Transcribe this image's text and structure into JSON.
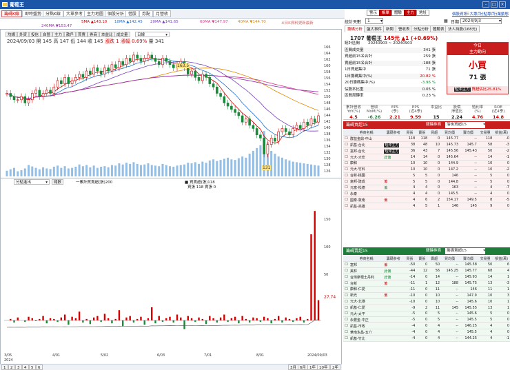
{
  "window": {
    "title": "葡萄王",
    "controls": [
      "-",
      "□",
      "×"
    ]
  },
  "toolbar": {
    "tabs": [
      {
        "label": "籌碼K線",
        "active": true
      },
      {
        "label": "即時盤勢",
        "active": false
      },
      {
        "label": "分點K線",
        "active": false
      },
      {
        "label": "大單參考",
        "active": false
      },
      {
        "label": "主力地圖",
        "active": false
      },
      {
        "label": "個股分析",
        "active": false
      },
      {
        "label": "借股",
        "active": false
      },
      {
        "label": "券配",
        "active": false
      },
      {
        "label": "月營收",
        "active": false
      }
    ]
  },
  "ma_legend": [
    {
      "label": "5MA ▲143.10",
      "color": "#d40000"
    },
    {
      "label": "10MA ▲142.45",
      "color": "#1f6fd4"
    },
    {
      "label": "20MA ▲141.65",
      "color": "#7a3fc0"
    },
    {
      "label": "60MA ▼147.97",
      "color": "#d63a8c"
    },
    {
      "label": "40MA ▼144.70",
      "color": "#e08a00"
    }
  ],
  "ma_legend2": {
    "label": "240MA ▼153.47",
    "color": "#9b2fb0"
  },
  "chart_toolbar": {
    "buttons": [
      "均線",
      "外資",
      "投信",
      "自營",
      "主力",
      "散戶",
      "買賣",
      "券商",
      "本益比",
      "成交量",
      "日線"
    ],
    "note": "※日K資料更新最新",
    "status": "日線"
  },
  "quote_info": {
    "date": "2024/09/03",
    "open_label": "開",
    "open": "145",
    "high_label": "高",
    "high": "147",
    "low_label": "低",
    "low": "144",
    "close_label": "收",
    "close": "145",
    "change_label": "漲跌",
    "change": "1",
    "pct_label": "漲幅",
    "pct": "0.69%",
    "vol_label": "量",
    "vol": "341"
  },
  "price_axis": [
    "166",
    "164",
    "162",
    "160",
    "158",
    "156",
    "154",
    "152",
    "150",
    "148",
    "146",
    "144",
    "142",
    "140",
    "138",
    "136",
    "134",
    "132",
    "130",
    "128",
    "126"
  ],
  "peak_label": "163.5",
  "low_label": "131",
  "sub_panel": {
    "select": "分點進出",
    "button": "總數",
    "legend_total": "一累計買賣超(張)200",
    "legend_buy": "■ 買賣超(張)118",
    "legend_sell": "買張 118 賣張 0",
    "axis": [
      "150",
      "100",
      "50"
    ],
    "current_value": "27.74"
  },
  "x_axis": [
    "3/05",
    "4/01",
    "5/02",
    "6/03",
    "7/01",
    "8/01",
    "2024/09/03"
  ],
  "x_axis_year": "2024",
  "bottom_tabs": [
    "1",
    "2",
    "3",
    "4",
    "5",
    "6"
  ],
  "period_buttons": [
    "3月",
    "6月",
    "1年",
    "10年",
    "2年"
  ],
  "right_nav": {
    "buttons": [
      {
        "label": "警示",
        "style": "normal"
      },
      {
        "label": "帳單",
        "style": "red"
      },
      {
        "label": "體驗",
        "style": "normal"
      },
      {
        "label": "主力",
        "style": "red"
      },
      {
        "label": "地址",
        "style": "normal"
      }
    ],
    "links": [
      "個股資訊",
      "三大專戶",
      "分點專戶",
      "行業動態"
    ]
  },
  "filter": {
    "label": "統計天數",
    "days": "1",
    "date_label": "日期",
    "date": "2024/9/3"
  },
  "right_tabs": [
    {
      "label": "籌碼分析",
      "active": true
    },
    {
      "label": "盤大事件",
      "active": false
    },
    {
      "label": "新聞",
      "active": false
    },
    {
      "label": "營收表",
      "active": false
    },
    {
      "label": "分點分析",
      "active": false
    },
    {
      "label": "體驗表",
      "active": false
    },
    {
      "label": "法人持股(168元)",
      "active": false
    }
  ],
  "stock": {
    "code_name": "1707 葡萄王",
    "price": "145元",
    "change": "▲1 (+0.69%)"
  },
  "stats": [
    {
      "label": "統計區間",
      "value": "20240903 ~ 20240903",
      "color": ""
    },
    {
      "label": "區間成交量",
      "value": "341 張",
      "color": ""
    },
    {
      "label": "買超前15名合計",
      "value": "259 張",
      "color": ""
    },
    {
      "label": "賣超前15名合計",
      "value": "-188 張",
      "color": ""
    },
    {
      "label": "1日買超集中",
      "value": "71 張",
      "color": ""
    },
    {
      "label": "1日籌碼集中(%)",
      "value": "20.82 %",
      "color": "#d40000"
    },
    {
      "label": "20日籌碼集中(%)",
      "value": "-3.96 %",
      "color": "#1a8a3a"
    },
    {
      "label": "佔股本比重",
      "value": "0.05 %",
      "color": ""
    },
    {
      "label": "區間周轉率",
      "value": "0.23 %",
      "color": ""
    }
  ],
  "today_box": {
    "title": "今日",
    "subtitle": "主力動向",
    "main": "小買",
    "lots": "71 張",
    "footer_label": "短沖主力",
    "footer_value": "買超佔比25.81%"
  },
  "fin_headers": [
    "累計營收\nYoY(%)",
    "營收\nMoM(%)",
    "EPS\n(季)",
    "EPS\n(近4季)",
    "本益比",
    "股價\n淨值比",
    "殖利率\n(%)",
    "ROE\n(近4季)"
  ],
  "fin_values": [
    {
      "v": "4.5",
      "c": "#d40000"
    },
    {
      "v": "-6.26",
      "c": "#1a8a3a"
    },
    {
      "v": "2.21",
      "c": "#d40000"
    },
    {
      "v": "9.59",
      "c": "#d40000"
    },
    {
      "v": "15",
      "c": "#222"
    },
    {
      "v": "2.24",
      "c": "#222"
    },
    {
      "v": "4.76",
      "c": "#d40000"
    },
    {
      "v": "14.8",
      "c": "#d40000"
    }
  ],
  "buy_section": {
    "title": "籌碼買超15",
    "select_label": "關鍵券商",
    "select_value": "落後買超15",
    "headers": [
      "",
      "券商名稱",
      "籌碼參考",
      "買張",
      "賣張",
      "買超",
      "買均價",
      "賣均價",
      "交易量",
      "損益(萬)"
    ],
    "rows": [
      {
        "name": "群益金鼎-中山",
        "tag": "",
        "tagc": "",
        "buy": "118",
        "sell": "118",
        "net": "0",
        "bavg": "145.77",
        "savg": "--",
        "vol": "118",
        "pl": "-0"
      },
      {
        "name": "凱基-台北",
        "tag": "短沖主力",
        "tagc": "blk",
        "buy": "38",
        "sell": "48",
        "net": "10",
        "bavg": "145.73",
        "savg": "145.7",
        "vol": "58",
        "pl": "-3"
      },
      {
        "name": "富邦-台北",
        "tag": "短沖主力",
        "tagc": "blk",
        "buy": "36",
        "sell": "43",
        "net": "7",
        "bavg": "145.56",
        "savg": "145.43",
        "vol": "50",
        "pl": "-2"
      },
      {
        "name": "元大-大安",
        "tag": "此偏",
        "tagc": "grn",
        "buy": "14",
        "sell": "14",
        "net": "0",
        "bavg": "145.64",
        "savg": "--",
        "vol": "14",
        "pl": "-1"
      },
      {
        "name": "康和",
        "tag": "",
        "tagc": "",
        "buy": "10",
        "sell": "10",
        "net": "0",
        "bavg": "144.9",
        "savg": "--",
        "vol": "10",
        "pl": "0"
      },
      {
        "name": "元大-竹科",
        "tag": "",
        "tagc": "",
        "buy": "10",
        "sell": "10",
        "net": "0",
        "bavg": "147.2",
        "savg": "--",
        "vol": "10",
        "pl": "-2"
      },
      {
        "name": "台新-桃園",
        "tag": "",
        "tagc": "",
        "buy": "5",
        "sell": "5",
        "net": "0",
        "bavg": "146",
        "savg": "--",
        "vol": "5",
        "pl": "0"
      },
      {
        "name": "富邦-建成",
        "tag": "偏",
        "tagc": "red",
        "buy": "5",
        "sell": "5",
        "net": "0",
        "bavg": "144.8",
        "savg": "--",
        "vol": "5",
        "pl": "0"
      },
      {
        "name": "元富-松德",
        "tag": "偏",
        "tagc": "grn",
        "buy": "4",
        "sell": "4",
        "net": "0",
        "bavg": "163",
        "savg": "--",
        "vol": "4",
        "pl": "-7"
      },
      {
        "name": "永泰",
        "tag": "",
        "tagc": "",
        "buy": "4",
        "sell": "4",
        "net": "0",
        "bavg": "145.5",
        "savg": "--",
        "vol": "4",
        "pl": "0"
      },
      {
        "name": "國泰-敦南",
        "tag": "偏",
        "tagc": "red",
        "buy": "4",
        "sell": "6",
        "net": "2",
        "bavg": "154.17",
        "savg": "149.5",
        "vol": "8",
        "pl": "-5"
      },
      {
        "name": "凱基-高雄",
        "tag": "",
        "tagc": "",
        "buy": "4",
        "sell": "5",
        "net": "1",
        "bavg": "146",
        "savg": "145",
        "vol": "9",
        "pl": "0"
      }
    ]
  },
  "sell_section": {
    "title": "籌碼賣超15",
    "select_label": "關鍵券商",
    "select_value": "籌碼賣超15",
    "headers": [
      "",
      "券商名稱",
      "籌碼參考",
      "買張",
      "賣張",
      "賣超",
      "買均價",
      "賣均價",
      "交易量",
      "損益(萬)"
    ],
    "rows": [
      {
        "name": "富邦",
        "tag": "偏",
        "tagc": "red",
        "buy": "-50",
        "sell": "0",
        "net": "50",
        "bavg": "--",
        "savg": "145.58",
        "vol": "50",
        "pl": "6"
      },
      {
        "name": "美林",
        "tag": "此偏",
        "tagc": "grn",
        "buy": "-44",
        "sell": "12",
        "net": "56",
        "bavg": "145.25",
        "savg": "145.77",
        "vol": "68",
        "pl": "4"
      },
      {
        "name": "台灣摩根士丹利",
        "tag": "此偏",
        "tagc": "grn",
        "buy": "-14",
        "sell": "0",
        "net": "14",
        "bavg": "--",
        "savg": "145.93",
        "vol": "14",
        "pl": "1"
      },
      {
        "name": "台新",
        "tag": "偏",
        "tagc": "red",
        "buy": "-11",
        "sell": "1",
        "net": "12",
        "bavg": "188",
        "savg": "145.75",
        "vol": "13",
        "pl": "-3"
      },
      {
        "name": "康和-仁愛",
        "tag": "",
        "tagc": "",
        "buy": "-11",
        "sell": "0",
        "net": "11",
        "bavg": "--",
        "savg": "146",
        "vol": "11",
        "pl": "1"
      },
      {
        "name": "新光",
        "tag": "偏",
        "tagc": "red",
        "buy": "-10",
        "sell": "0",
        "net": "10",
        "bavg": "--",
        "savg": "147.9",
        "vol": "10",
        "pl": "3"
      },
      {
        "name": "元大-北港",
        "tag": "",
        "tagc": "",
        "buy": "-10",
        "sell": "0",
        "net": "10",
        "bavg": "--",
        "savg": "145.6",
        "vol": "10",
        "pl": "1"
      },
      {
        "name": "凱基-仁愛",
        "tag": "",
        "tagc": "",
        "buy": "-9",
        "sell": "2",
        "net": "11",
        "bavg": "145",
        "savg": "145.55",
        "vol": "13",
        "pl": "1"
      },
      {
        "name": "元大-太平",
        "tag": "",
        "tagc": "",
        "buy": "-5",
        "sell": "0",
        "net": "5",
        "bavg": "--",
        "savg": "145.6",
        "vol": "5",
        "pl": "0"
      },
      {
        "name": "永豐金-中正",
        "tag": "",
        "tagc": "",
        "buy": "-5",
        "sell": "0",
        "net": "5",
        "bavg": "--",
        "savg": "145.5",
        "vol": "5",
        "pl": "0"
      },
      {
        "name": "凱基-市政",
        "tag": "",
        "tagc": "",
        "buy": "-4",
        "sell": "0",
        "net": "4",
        "bavg": "--",
        "savg": "146.25",
        "vol": "4",
        "pl": "0"
      },
      {
        "name": "華南永昌-五介",
        "tag": "",
        "tagc": "",
        "buy": "-4",
        "sell": "0",
        "net": "4",
        "bavg": "--",
        "savg": "145.5",
        "vol": "4",
        "pl": "0"
      },
      {
        "name": "凱基-竹北",
        "tag": "",
        "tagc": "",
        "buy": "-4",
        "sell": "0",
        "net": "4",
        "bavg": "--",
        "savg": "144.25",
        "vol": "4",
        "pl": "-1"
      }
    ]
  },
  "colors": {
    "accent": "#1b55a8",
    "up": "#d40000",
    "down": "#1a8a3a",
    "volume": "#6fa8dc"
  },
  "chart_data": {
    "type": "candlestick",
    "title": "",
    "ylim": [
      126,
      167
    ],
    "x_labels": [
      "3/05",
      "4/01",
      "5/02",
      "6/03",
      "7/01",
      "8/01",
      "2024/09/03"
    ],
    "close_series": [
      152,
      151,
      150,
      150,
      151,
      149,
      150,
      152,
      153,
      151,
      152,
      153,
      152,
      154,
      156,
      155,
      157,
      155,
      156,
      157,
      158,
      157,
      159,
      158,
      160,
      159,
      158,
      160,
      159,
      161,
      160,
      162,
      161,
      163,
      162,
      164,
      163,
      162,
      163,
      164,
      163,
      162,
      161,
      163,
      162,
      161,
      160,
      161,
      162,
      160,
      158,
      159,
      157,
      156,
      158,
      157,
      155,
      154,
      152,
      151,
      149,
      148,
      147,
      146,
      145,
      143,
      144,
      142,
      141,
      139,
      138,
      133,
      136,
      138,
      137,
      140,
      141,
      140,
      139,
      141,
      142,
      141,
      143,
      142,
      144,
      143,
      145
    ],
    "ma_series": [
      {
        "name": "5MA",
        "color": "#d40000"
      },
      {
        "name": "10MA",
        "color": "#1f6fd4"
      },
      {
        "name": "20MA",
        "color": "#7a3fc0"
      },
      {
        "name": "60MA",
        "color": "#d63a8c"
      },
      {
        "name": "40MA",
        "color": "#e08a00"
      },
      {
        "name": "240MA",
        "color": "#9b2fb0"
      }
    ],
    "volume": [
      20,
      25,
      30,
      18,
      22,
      28,
      40,
      35,
      30,
      25,
      32,
      28,
      26,
      34,
      38,
      30,
      36,
      28,
      30,
      34,
      42,
      36,
      40,
      32,
      38,
      30,
      34,
      36,
      32,
      40,
      38,
      46,
      42,
      48,
      44,
      50,
      44,
      40,
      42,
      46,
      40,
      38,
      36,
      44,
      40,
      36,
      34,
      38,
      40,
      42,
      48,
      46,
      50,
      44,
      52,
      48,
      56,
      60,
      54,
      58,
      62,
      66,
      60,
      58,
      64,
      70,
      66,
      80,
      90,
      100,
      110,
      160,
      120,
      90,
      80,
      70,
      66,
      60,
      56,
      52,
      50,
      48,
      46,
      44,
      42,
      40,
      38
    ],
    "sub_bars": [
      0,
      2,
      -3,
      4,
      0,
      -2,
      5,
      3,
      -1,
      2,
      6,
      -4,
      3,
      2,
      -2,
      4,
      8,
      -6,
      5,
      3,
      12,
      -3,
      2,
      -5,
      4,
      6,
      -2,
      9,
      3,
      -4,
      2,
      14,
      -8,
      4,
      6,
      -3,
      2,
      5,
      -6,
      3,
      18,
      -4,
      6,
      -2,
      3,
      5,
      -3,
      8,
      4,
      -12,
      6,
      3,
      -2,
      4,
      2,
      -5,
      6,
      3,
      -3,
      4,
      8,
      -2,
      3,
      5,
      -4,
      6,
      2,
      -3,
      4,
      3,
      -2,
      5,
      3,
      -4,
      2,
      6,
      -3,
      4,
      2,
      -2,
      3,
      5,
      -3,
      2,
      118,
      150,
      27.74
    ]
  }
}
